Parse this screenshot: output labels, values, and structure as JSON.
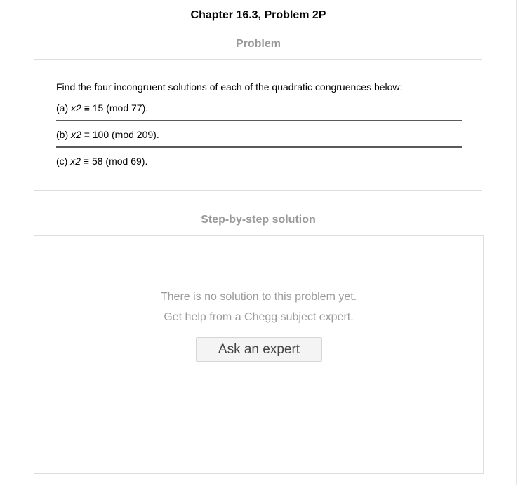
{
  "page": {
    "title": "Chapter 16.3, Problem 2P"
  },
  "problem": {
    "heading": "Problem",
    "intro": "Find the four incongruent solutions of each of the quadratic congruences below:",
    "parts": [
      {
        "label": "(a)",
        "variable": "x2",
        "rest": "≡ 15 (mod 77)."
      },
      {
        "label": "(b)",
        "variable": "x2",
        "rest": "≡ 100 (mod 209)."
      },
      {
        "label": "(c)",
        "variable": "x2",
        "rest": "≡ 58 (mod 69)."
      }
    ]
  },
  "solution": {
    "heading": "Step-by-step solution",
    "empty_line_1": "There is no solution to this problem yet.",
    "empty_line_2": "Get help from a Chegg subject expert.",
    "ask_button_label": "Ask an expert"
  }
}
